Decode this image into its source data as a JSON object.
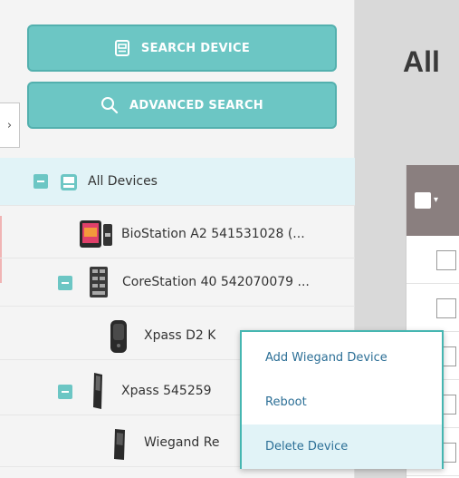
{
  "toolbar": {
    "search_device_label": "SEARCH DEVICE",
    "advanced_search_label": "ADVANCED SEARCH",
    "collapse_glyph": "›"
  },
  "tree": {
    "root_label": "All Devices",
    "devices": [
      {
        "label": "BioStation A2 541531028 (..."
      },
      {
        "label": "CoreStation 40 542070079 ..."
      },
      {
        "label": "Xpass D2 K"
      },
      {
        "label": "Xpass 545259"
      },
      {
        "label": "Wiegand Re"
      }
    ]
  },
  "main": {
    "title": "All"
  },
  "context_menu": {
    "items": [
      {
        "label": "Add Wiegand Device"
      },
      {
        "label": "Reboot"
      },
      {
        "label": "Delete Device"
      }
    ]
  },
  "colors": {
    "accent": "#6cc6c4",
    "menu_border": "#45b6b1",
    "menu_text": "#2c6f96",
    "selected_row": "#e1f3f7"
  },
  "icons": [
    "search-device-icon",
    "magnifier-icon",
    "chevron-right-icon",
    "collapse-minus-icon",
    "group-icon",
    "biostation-icon",
    "corestation-icon",
    "xpass-d2-icon",
    "xpass-icon",
    "wiegand-reader-icon"
  ]
}
